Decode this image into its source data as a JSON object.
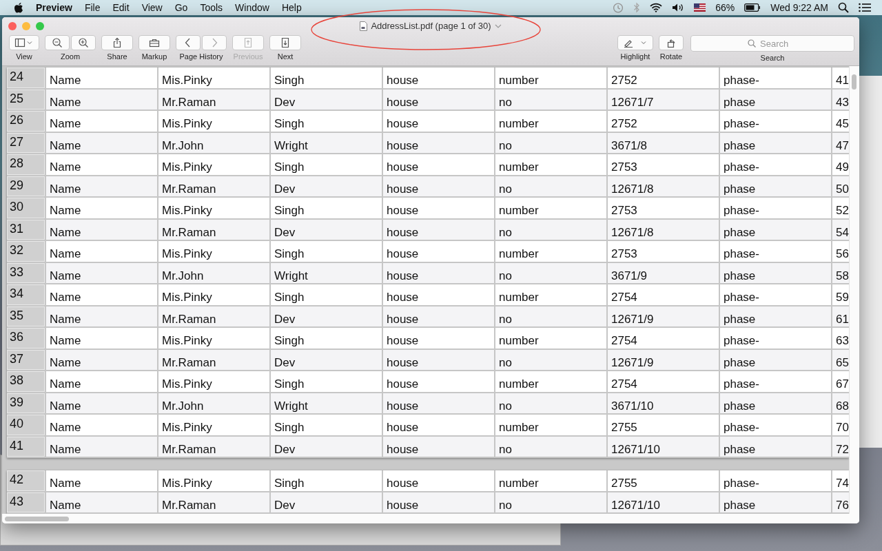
{
  "menu_bar": {
    "app": "Preview",
    "items": [
      "File",
      "Edit",
      "View",
      "Go",
      "Tools",
      "Window",
      "Help"
    ],
    "battery": "66%",
    "clock": "Wed 9:22 AM"
  },
  "window": {
    "title": "AddressList.pdf (page 1 of 30)"
  },
  "toolbar": {
    "items": [
      {
        "label": "View",
        "kind": "view",
        "disabled": false
      },
      {
        "label": "Zoom",
        "kind": "zoom",
        "disabled": false
      },
      {
        "label": "Share",
        "kind": "share",
        "disabled": false
      },
      {
        "label": "Markup",
        "kind": "markup",
        "disabled": false
      },
      {
        "label": "Page History",
        "kind": "history",
        "disabled": false
      },
      {
        "label": "Previous",
        "kind": "previous",
        "disabled": true
      },
      {
        "label": "Next",
        "kind": "next",
        "disabled": false
      }
    ],
    "right_items": [
      {
        "label": "Highlight",
        "kind": "highlight",
        "disabled": false
      },
      {
        "label": "Rotate",
        "kind": "rotate",
        "disabled": false
      }
    ],
    "search": {
      "placeholder": "Search",
      "label": "Search"
    }
  },
  "pages": [
    {
      "rows": [
        {
          "number": "24",
          "cells": [
            "Name",
            "Mis.Pinky",
            "Singh",
            "house",
            "number",
            "2752",
            "phase-",
            "41"
          ]
        },
        {
          "number": "25",
          "cells": [
            "Name",
            "Mr.Raman",
            "Dev",
            "house",
            "no",
            "12671/7",
            "phase",
            "43"
          ]
        },
        {
          "number": "26",
          "cells": [
            "Name",
            "Mis.Pinky",
            "Singh",
            "house",
            "number",
            "2752",
            "phase-",
            "45"
          ]
        },
        {
          "number": "27",
          "cells": [
            "Name",
            "Mr.John",
            "Wright",
            "house",
            "no",
            "3671/8",
            "phase",
            "47"
          ]
        },
        {
          "number": "28",
          "cells": [
            "Name",
            "Mis.Pinky",
            "Singh",
            "house",
            "number",
            "2753",
            "phase-",
            "49"
          ]
        },
        {
          "number": "29",
          "cells": [
            "Name",
            "Mr.Raman",
            "Dev",
            "house",
            "no",
            "12671/8",
            "phase",
            "50"
          ]
        },
        {
          "number": "30",
          "cells": [
            "Name",
            "Mis.Pinky",
            "Singh",
            "house",
            "number",
            "2753",
            "phase-",
            "52"
          ]
        },
        {
          "number": "31",
          "cells": [
            "Name",
            "Mr.Raman",
            "Dev",
            "house",
            "no",
            "12671/8",
            "phase",
            "54"
          ]
        },
        {
          "number": "32",
          "cells": [
            "Name",
            "Mis.Pinky",
            "Singh",
            "house",
            "number",
            "2753",
            "phase-",
            "56"
          ]
        },
        {
          "number": "33",
          "cells": [
            "Name",
            "Mr.John",
            "Wright",
            "house",
            "no",
            "3671/9",
            "phase",
            "58"
          ]
        },
        {
          "number": "34",
          "cells": [
            "Name",
            "Mis.Pinky",
            "Singh",
            "house",
            "number",
            "2754",
            "phase-",
            "59"
          ]
        },
        {
          "number": "35",
          "cells": [
            "Name",
            "Mr.Raman",
            "Dev",
            "house",
            "no",
            "12671/9",
            "phase",
            "61"
          ]
        },
        {
          "number": "36",
          "cells": [
            "Name",
            "Mis.Pinky",
            "Singh",
            "house",
            "number",
            "2754",
            "phase-",
            "63"
          ]
        },
        {
          "number": "37",
          "cells": [
            "Name",
            "Mr.Raman",
            "Dev",
            "house",
            "no",
            "12671/9",
            "phase",
            "65"
          ]
        },
        {
          "number": "38",
          "cells": [
            "Name",
            "Mis.Pinky",
            "Singh",
            "house",
            "number",
            "2754",
            "phase-",
            "67"
          ]
        },
        {
          "number": "39",
          "cells": [
            "Name",
            "Mr.John",
            "Wright",
            "house",
            "no",
            "3671/10",
            "phase",
            "68"
          ]
        },
        {
          "number": "40",
          "cells": [
            "Name",
            "Mis.Pinky",
            "Singh",
            "house",
            "number",
            "2755",
            "phase-",
            "70"
          ]
        },
        {
          "number": "41",
          "cells": [
            "Name",
            "Mr.Raman",
            "Dev",
            "house",
            "no",
            "12671/10",
            "phase",
            "72"
          ]
        }
      ]
    },
    {
      "rows": [
        {
          "number": "42",
          "cells": [
            "Name",
            "Mis.Pinky",
            "Singh",
            "house",
            "number",
            "2755",
            "phase-",
            "74"
          ]
        },
        {
          "number": "43",
          "cells": [
            "Name",
            "Mr.Raman",
            "Dev",
            "house",
            "no",
            "12671/10",
            "phase",
            "76"
          ]
        }
      ]
    }
  ]
}
